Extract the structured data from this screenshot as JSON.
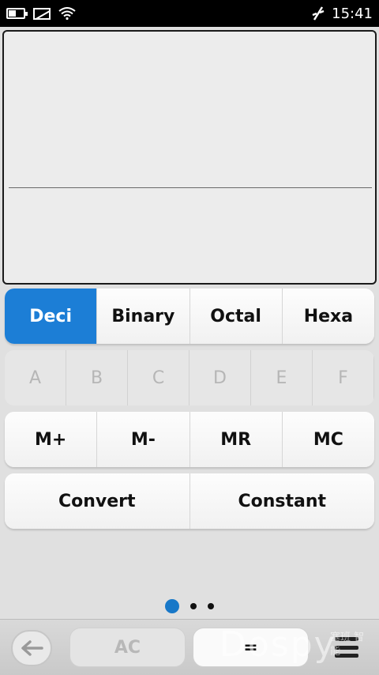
{
  "status_bar": {
    "time": "15:41",
    "icons": [
      "battery-icon",
      "no-sim-icon",
      "wifi-icon",
      "usb-icon"
    ]
  },
  "display": {
    "expression": "",
    "result": ""
  },
  "base_tabs": [
    {
      "label": "Deci",
      "active": true
    },
    {
      "label": "Binary",
      "active": false
    },
    {
      "label": "Octal",
      "active": false
    },
    {
      "label": "Hexa",
      "active": false
    }
  ],
  "hex_keys": [
    "A",
    "B",
    "C",
    "D",
    "E",
    "F"
  ],
  "memory_keys": [
    "M+",
    "M-",
    "MR",
    "MC"
  ],
  "function_keys": [
    "Convert",
    "Constant"
  ],
  "pager": {
    "pages": 3,
    "current": 1
  },
  "toolbar": {
    "ac_label": "AC",
    "equals_label": "="
  },
  "watermark": {
    "text": "Dospy",
    "sub": "塞班 智能"
  },
  "colors": {
    "accent": "#1c7ed6",
    "background": "#e0e0e0",
    "status_bar": "#000000"
  }
}
